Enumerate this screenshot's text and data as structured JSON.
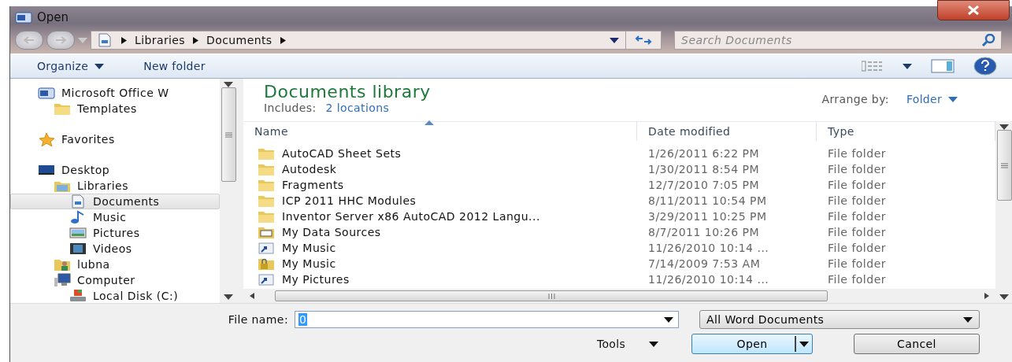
{
  "window": {
    "title": "Open"
  },
  "address": {
    "crumbs": [
      "Libraries",
      "Documents"
    ],
    "search_placeholder": "Search Documents"
  },
  "toolbar": {
    "organize": "Organize",
    "new_folder": "New folder"
  },
  "sidebar": {
    "items": [
      {
        "label": "Microsoft Office W",
        "kind": "word",
        "selected": false,
        "children": [
          {
            "label": "Templates",
            "kind": "folder",
            "selected": false
          }
        ]
      },
      {
        "label": "Favorites",
        "kind": "star",
        "selected": false
      },
      {
        "label": "Desktop",
        "kind": "desktop",
        "selected": false,
        "children": [
          {
            "label": "Libraries",
            "kind": "library",
            "selected": false,
            "children": [
              {
                "label": "Documents",
                "kind": "document",
                "selected": true
              },
              {
                "label": "Music",
                "kind": "music",
                "selected": false
              },
              {
                "label": "Pictures",
                "kind": "picture",
                "selected": false
              },
              {
                "label": "Videos",
                "kind": "video",
                "selected": false
              }
            ]
          },
          {
            "label": "lubna",
            "kind": "user",
            "selected": false
          },
          {
            "label": "Computer",
            "kind": "computer",
            "selected": false,
            "children": [
              {
                "label": "Local Disk (C:)",
                "kind": "disk",
                "selected": false
              }
            ]
          }
        ]
      }
    ]
  },
  "library": {
    "title": "Documents library",
    "includes_label": "Includes:",
    "includes_link": "2 locations",
    "arrange_label": "Arrange by:",
    "arrange_value": "Folder"
  },
  "table": {
    "columns": [
      {
        "label": "Name",
        "sorted": true
      },
      {
        "label": "Date modified",
        "sorted": false
      },
      {
        "label": "Type",
        "sorted": false
      }
    ],
    "rows": [
      {
        "kind": "folder",
        "name": "AutoCAD Sheet Sets",
        "date": "1/26/2011 6:22 PM",
        "type": "File folder"
      },
      {
        "kind": "folder",
        "name": "Autodesk",
        "date": "1/30/2011 8:54 PM",
        "type": "File folder"
      },
      {
        "kind": "folder",
        "name": "Fragments",
        "date": "12/7/2010 7:05 PM",
        "type": "File folder"
      },
      {
        "kind": "folder",
        "name": "ICP 2011 HHC Modules",
        "date": "8/11/2011 10:54 PM",
        "type": "File folder"
      },
      {
        "kind": "folder",
        "name": "Inventor Server x86 AutoCAD 2012 Langu...",
        "date": "3/29/2011 10:25 PM",
        "type": "File folder"
      },
      {
        "kind": "data",
        "name": "My Data Sources",
        "date": "8/7/2011 10:26 PM",
        "type": "File folder"
      },
      {
        "kind": "shortcut",
        "name": "My Music",
        "date": "11/26/2010 10:14 ...",
        "type": "File folder"
      },
      {
        "kind": "locked",
        "name": "My Music",
        "date": "7/14/2009 7:53 AM",
        "type": "File folder"
      },
      {
        "kind": "shortcut",
        "name": "My Pictures",
        "date": "11/26/2010 10:14 ...",
        "type": "File folder"
      }
    ]
  },
  "footer": {
    "file_name_label": "File name:",
    "file_name_value": "0",
    "filter": "All Word Documents",
    "tools": "Tools",
    "open": "Open",
    "cancel": "Cancel"
  }
}
